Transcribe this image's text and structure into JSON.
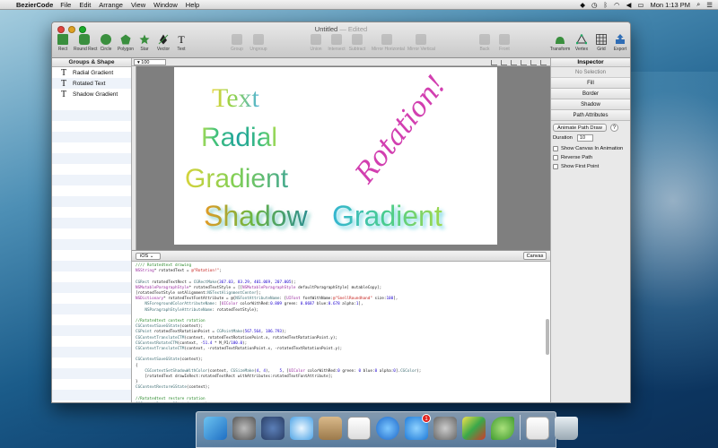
{
  "menubar": {
    "app_name": "BezierCode",
    "menus": [
      "File",
      "Edit",
      "Arrange",
      "View",
      "Window",
      "Help"
    ],
    "clock": "Mon 1:13 PM"
  },
  "window": {
    "title": "Untitled",
    "title_status": "— Edited"
  },
  "toolbar": {
    "shapes": [
      "Rect",
      "Round Rect",
      "Circle",
      "Polygon",
      "Star",
      "Vector",
      "Text"
    ],
    "group": [
      "Group",
      "Ungroup"
    ],
    "path_ops": [
      "Union",
      "Intersect",
      "Subtract",
      "Mirror Horizontal",
      "Mirror Vertical"
    ],
    "arrange": [
      "Back",
      "Front"
    ],
    "right": [
      "Transform",
      "Vertex",
      "Grid",
      "Export"
    ]
  },
  "left_panel": {
    "header": "Groups & Shape",
    "items": [
      "Radial Gradient",
      "Rotated Text",
      "Shadow Gradient"
    ]
  },
  "canvas": {
    "zoom": "100",
    "texts": {
      "text": "Text",
      "radial": "Radial",
      "gradient": "Gradient",
      "shadow": "Shadow",
      "shadow_gradient": "Gradient",
      "rotation": "Rotation!"
    }
  },
  "code_panel": {
    "platform": "iOS",
    "canvas_button": "Canvas"
  },
  "inspector": {
    "header": "Inspector",
    "no_selection": "No Selection",
    "sections": [
      "Fill",
      "Border",
      "Shadow",
      "Path Attributes"
    ],
    "animate_button": "Animate Path Draw",
    "help": "?",
    "duration_label": "Duration",
    "duration_value": "10",
    "checkboxes": [
      "Show Canvas In Animation",
      "Reverse Path",
      "Show First Point"
    ]
  }
}
